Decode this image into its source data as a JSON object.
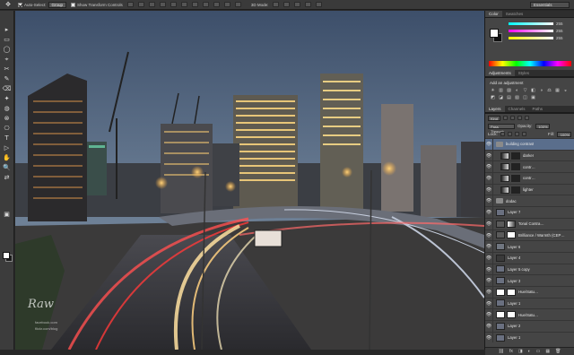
{
  "options_bar": {
    "auto_select_label": "Auto-Select:",
    "auto_select_value": "Group",
    "show_transform_label": "Show Transform Controls",
    "mode_label": "3D Mode:",
    "workspace": "Essentials"
  },
  "color_panel": {
    "tabs": [
      "Color",
      "Swatches"
    ],
    "r": "255",
    "g": "255",
    "b": "255"
  },
  "adjustments_panel": {
    "tabs": [
      "Adjustments",
      "Styles"
    ],
    "title": "Add an adjustment",
    "icons": [
      "☀",
      "▥",
      "▨",
      "◐",
      "▽",
      "◧",
      "◑",
      "⚖",
      "▦",
      "◒",
      "◩",
      "◪",
      "▤",
      "▧",
      "◫",
      "▣",
      "◰",
      "◳",
      "◲",
      "◱"
    ]
  },
  "layers_panel": {
    "tabs": [
      "Layers",
      "Channels",
      "Paths"
    ],
    "kind_label": "Kind",
    "blend_mode": "Pass Through",
    "opacity_label": "Opacity:",
    "opacity": "100%",
    "lock_label": "Lock:",
    "fill_label": "Fill:",
    "fill": "100%",
    "layers": [
      {
        "name": "building contrast",
        "type": "group",
        "selected": true
      },
      {
        "name": "darker",
        "type": "adjust"
      },
      {
        "name": "contr…",
        "type": "adjust"
      },
      {
        "name": "contr…",
        "type": "adjust"
      },
      {
        "name": "lighter",
        "type": "adjust"
      },
      {
        "name": "dodac",
        "type": "group"
      },
      {
        "name": "Layer 7",
        "type": "pixel"
      },
      {
        "name": "Tonal Contra…",
        "type": "adjust"
      },
      {
        "name": "Brilliance / Warmth (CEP…",
        "type": "adjust"
      },
      {
        "name": "Layer 6",
        "type": "pixel"
      },
      {
        "name": "Layer 4",
        "type": "pixel"
      },
      {
        "name": "Layer 5 copy",
        "type": "pixel"
      },
      {
        "name": "Layer 3",
        "type": "pixel"
      },
      {
        "name": "Hue/Satu…",
        "type": "adjust"
      },
      {
        "name": "Layer 1",
        "type": "pixel"
      },
      {
        "name": "Hue/Satu…",
        "type": "adjust"
      },
      {
        "name": "Layer 2",
        "type": "pixel"
      },
      {
        "name": "Layer 1",
        "type": "pixel"
      }
    ],
    "footer_icons": [
      "⛓",
      "fx",
      "◨",
      "◐",
      "▭",
      "▦",
      "🗑"
    ]
  },
  "tools": [
    "▸",
    "▭",
    "◯",
    "⌖",
    "✂",
    "✎",
    "⌫",
    "✦",
    "◍",
    "⊗",
    "⎔",
    "T",
    "▷",
    "✋",
    "🔍",
    "⇄",
    "▣"
  ],
  "canvas": {
    "signature": "Raw",
    "watermark_lines": [
      "facebook.com",
      "flickr.com/blog"
    ],
    "billboard_text": ""
  }
}
